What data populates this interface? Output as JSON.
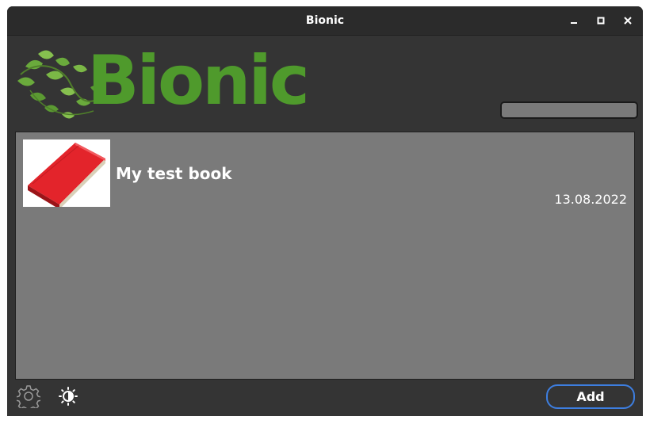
{
  "window": {
    "title": "Bionic"
  },
  "header": {
    "logo_text": "Bionic",
    "search": {
      "value": "",
      "placeholder": ""
    }
  },
  "books": [
    {
      "title": "My test book",
      "date": "13.08.2022",
      "cover": "red-book-cover"
    }
  ],
  "footer": {
    "settings_icon": "gear-icon",
    "theme_icon": "brightness-icon",
    "add_label": "Add"
  },
  "colors": {
    "window_bg": "#343434",
    "titlebar_bg": "#2b2b2b",
    "list_bg": "#7a7a7a",
    "logo_green": "#4f9a2c",
    "accent_blue": "#3d7ee0"
  }
}
